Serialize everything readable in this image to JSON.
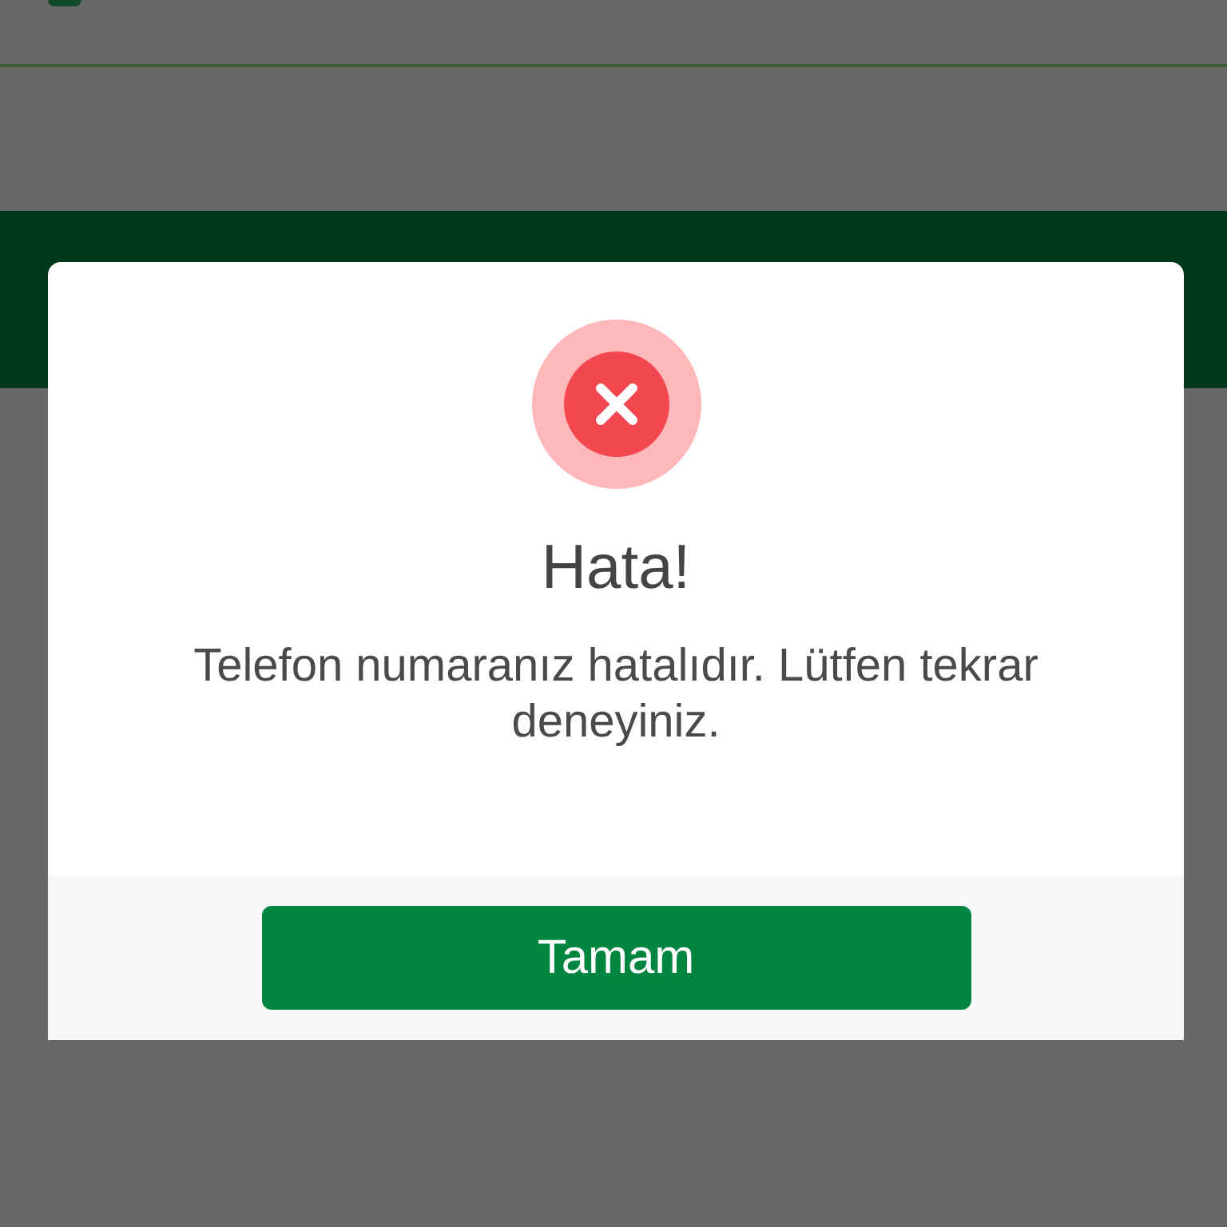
{
  "dialog": {
    "title": "Hata!",
    "message": "Telefon numaranız hatalıdır. Lütfen tekrar deneyiniz.",
    "buttons": [
      {
        "label": "Tamam"
      }
    ]
  }
}
